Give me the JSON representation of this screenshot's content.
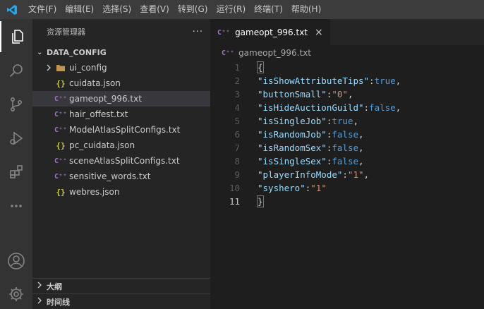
{
  "menu": [
    "文件(F)",
    "编辑(E)",
    "选择(S)",
    "查看(V)",
    "转到(G)",
    "运行(R)",
    "终端(T)",
    "帮助(H)"
  ],
  "sidebar": {
    "title": "资源管理器",
    "more": "···",
    "folder": "DATA_CONFIG",
    "items": [
      {
        "label": "ui_config",
        "icon": "folder-icon"
      },
      {
        "label": "cuidata.json",
        "icon": "json-icon"
      },
      {
        "label": "gameopt_996.txt",
        "icon": "cpp-icon"
      },
      {
        "label": "hair_offest.txt",
        "icon": "cpp-icon"
      },
      {
        "label": "ModelAtlasSplitConfigs.txt",
        "icon": "cpp-icon"
      },
      {
        "label": "pc_cuidata.json",
        "icon": "json-icon"
      },
      {
        "label": "sceneAtlasSplitConfigs.txt",
        "icon": "cpp-icon"
      },
      {
        "label": "sensitive_words.txt",
        "icon": "cpp-icon"
      },
      {
        "label": "webres.json",
        "icon": "json-icon"
      }
    ],
    "outline": "大纲",
    "timeline": "时间线"
  },
  "editor": {
    "tab_label": "gameopt_996.txt",
    "tab_close": "×",
    "breadcrumb": "gameopt_996.txt",
    "lines": [
      {
        "n": "1",
        "key": "",
        "val": "",
        "brace": "{"
      },
      {
        "n": "2",
        "key": "\"isShowAttributeTips\"",
        "val": "true",
        "vtype": "bool",
        "comma": ","
      },
      {
        "n": "3",
        "key": "\"buttonSmall\"",
        "val": "\"0\"",
        "vtype": "str",
        "comma": ","
      },
      {
        "n": "4",
        "key": "\"isHideAuctionGuild\"",
        "val": "false",
        "vtype": "bool",
        "comma": ","
      },
      {
        "n": "5",
        "key": "\"isSingleJob\"",
        "val": "true",
        "vtype": "bool",
        "comma": ","
      },
      {
        "n": "6",
        "key": "\"isRandomJob\"",
        "val": "false",
        "vtype": "bool",
        "comma": ","
      },
      {
        "n": "7",
        "key": "\"isRandomSex\"",
        "val": "false",
        "vtype": "bool",
        "comma": ","
      },
      {
        "n": "8",
        "key": "\"isSingleSex\"",
        "val": "false",
        "vtype": "bool",
        "comma": ","
      },
      {
        "n": "9",
        "key": "\"playerInfoMode\"",
        "val": "\"1\"",
        "vtype": "str",
        "comma": ","
      },
      {
        "n": "10",
        "key": "\"syshero\"",
        "val": "\"1\"",
        "vtype": "str",
        "comma": ""
      },
      {
        "n": "11",
        "key": "",
        "val": "",
        "brace": "}"
      }
    ],
    "current_line": "11"
  },
  "colors": {
    "title_bar": "#3c3c3c",
    "activity_bar": "#333333",
    "sidebar": "#252526",
    "editor": "#1e1e1e",
    "selected_item": "#37373d",
    "key": "#9cdcfe",
    "bool": "#569cd6",
    "string": "#ce9178",
    "vscode_blue": "#23a9f2"
  }
}
